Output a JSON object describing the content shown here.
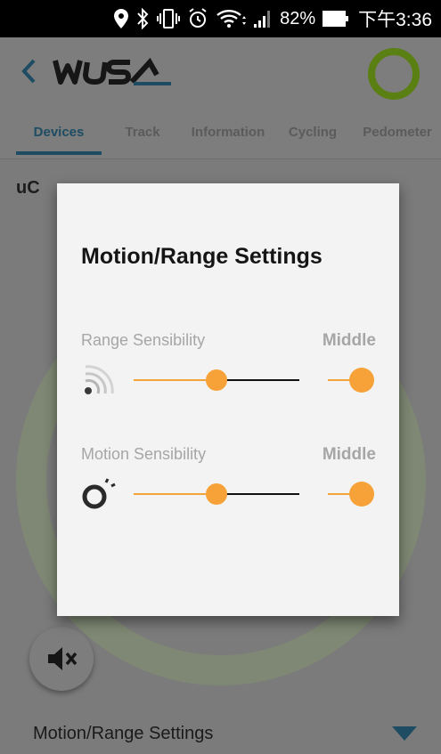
{
  "status_bar": {
    "battery_percent": "82%",
    "time": "下午3:36"
  },
  "app_bar": {
    "logo_icon": "wusa-logo-icon",
    "back_icon": "chevron-left-icon",
    "ring_icon": "device-ring-icon",
    "accent_color": "#5a7f12"
  },
  "tabs": [
    {
      "label": "Devices",
      "active": true
    },
    {
      "label": "Track",
      "active": false
    },
    {
      "label": "Information",
      "active": false
    },
    {
      "label": "Cycling",
      "active": false
    },
    {
      "label": "Pedometer",
      "active": false
    }
  ],
  "content": {
    "device_name_visible": "uC",
    "mute_icon": "speaker-muted-icon",
    "section_label": "Motion/Range Settings",
    "expand_icon": "caret-down-icon",
    "expand_color": "#1d4c63"
  },
  "dialog": {
    "title": "Motion/Range Settings",
    "accent_color": "#f6a239",
    "settings": [
      {
        "label": "Range Sensibility",
        "value": "Middle",
        "icon": "signal-waves-icon",
        "slider_level": 0.5,
        "toggle_on": true
      },
      {
        "label": "Motion Sensibility",
        "value": "Middle",
        "icon": "motion-ring-icon",
        "slider_level": 0.5,
        "toggle_on": true
      }
    ]
  }
}
